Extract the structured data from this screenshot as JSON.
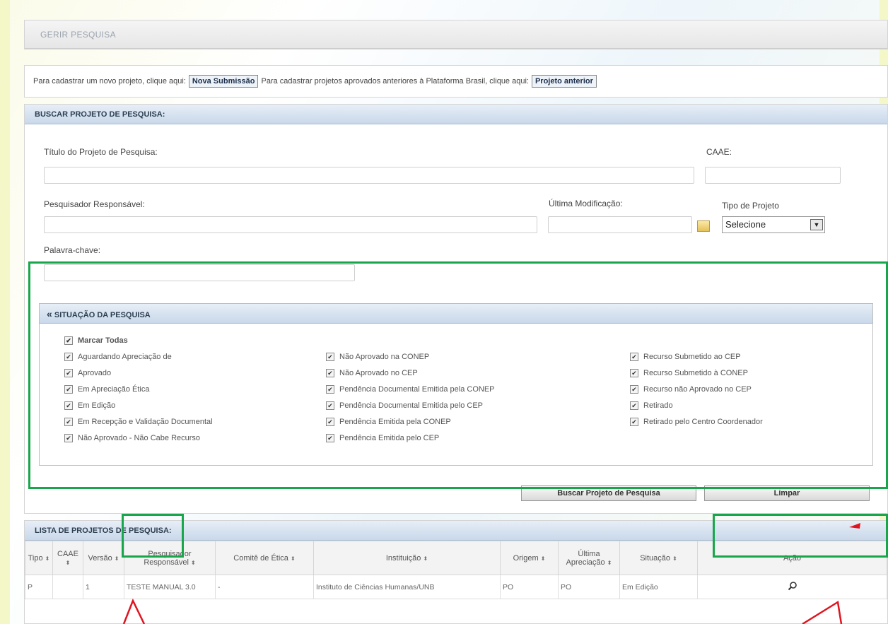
{
  "gerir": {
    "title": "GERIR PESQUISA"
  },
  "intro": {
    "text1": "Para cadastrar um novo projeto, clique aqui:",
    "nova_btn": "Nova Submissão",
    "text2": "Para cadastrar projetos aprovados anteriores à Plataforma Brasil, clique aqui:",
    "anterior_btn": "Projeto anterior"
  },
  "busca": {
    "title": "BUSCAR PROJETO DE PESQUISA:",
    "titulo_label": "Título do Projeto de Pesquisa:",
    "caae_label": "CAAE:",
    "pesquisador_label": "Pesquisador Responsável:",
    "ultima_label": "Última Modificação:",
    "tipo_label": "Tipo de Projeto",
    "tipo_value": "Selecione",
    "palavra_label": "Palavra-chave:",
    "buscar_btn": "Buscar Projeto de Pesquisa",
    "limpar_btn": "Limpar"
  },
  "situacao": {
    "title": "SITUAÇÃO DA PESQUISA",
    "collapse_glyph": "«",
    "marcar_todas": "Marcar Todas",
    "col1": [
      "Aguardando Apreciação de",
      "Aprovado",
      "Em Apreciação Ética",
      "Em Edição",
      "Em Recepção e Validação Documental",
      "Não Aprovado - Não Cabe Recurso"
    ],
    "col2": [
      "Não Aprovado na CONEP",
      "Não Aprovado no CEP",
      "Pendência Documental Emitida pela CONEP",
      "Pendência Documental Emitida pelo CEP",
      "Pendência Emitida pela CONEP",
      "Pendência Emitida pelo CEP"
    ],
    "col3": [
      "Recurso Submetido ao CEP",
      "Recurso Submetido à CONEP",
      "Recurso não Aprovado no CEP",
      "Retirado",
      "Retirado pelo Centro Coordenador"
    ]
  },
  "lista": {
    "title": "LISTA DE PROJETOS DE PESQUISA:",
    "columns": [
      "Tipo",
      "CAAE",
      "Versão",
      "Pesquisador Responsável",
      "Comitê de Ética",
      "Instituição",
      "Origem",
      "Última Apreciação",
      "Situação",
      "Ação"
    ],
    "row": {
      "tipo": "P",
      "caae": "",
      "versao": "1",
      "pesquisador": "TESTE MANUAL 3.0",
      "comite": "-",
      "instituicao": "Instituto de Ciências Humanas/UNB",
      "origem": "PO",
      "ultima": "PO",
      "situacao": "Em Edição"
    }
  },
  "colors": {
    "highlight_green": "#18a64a",
    "arrow_red": "#e0141e",
    "section_header": "#c9d8ea"
  },
  "icons": {
    "calendar": "calendar-icon",
    "search": "magnifier-icon",
    "checkbox": "check-icon"
  }
}
